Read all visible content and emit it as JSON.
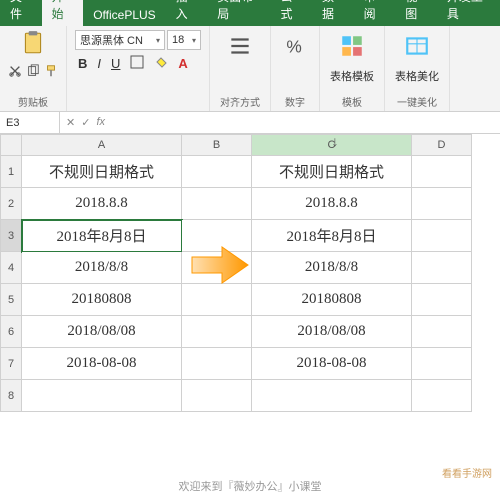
{
  "tabs": {
    "file": "文件",
    "home": "开始",
    "officeplus": "OfficePLUS",
    "insert": "插入",
    "layout": "页面布局",
    "formulas": "公式",
    "data": "数据",
    "review": "审阅",
    "view": "视图",
    "developer": "开发工具"
  },
  "ribbon": {
    "clipboard": "剪贴板",
    "font_name": "思源黑体 CN",
    "font_size": "18",
    "align": "对齐方式",
    "number": "数字",
    "templates": "表格模板",
    "beautify": "表格美化",
    "tpl_group": "模板",
    "beautify_group": "一键美化"
  },
  "namebox": "E3",
  "formula": "",
  "columns": {
    "a": "A",
    "b": "B",
    "c": "C",
    "d": "D"
  },
  "rows": [
    "1",
    "2",
    "3",
    "4",
    "5",
    "6",
    "7",
    "8"
  ],
  "data": {
    "a": [
      "不规则日期格式",
      "2018.8.8",
      "2018年8月8日",
      "2018/8/8",
      "20180808",
      "2018/08/08",
      "2018-08-08",
      ""
    ],
    "c": [
      "不规则日期格式",
      "2018.8.8",
      "2018年8月8日",
      "2018/8/8",
      "20180808",
      "2018/08/08",
      "2018-08-08",
      ""
    ]
  },
  "footer": "欢迎来到『薇妙办公』小课堂",
  "watermark": "看看手游网"
}
